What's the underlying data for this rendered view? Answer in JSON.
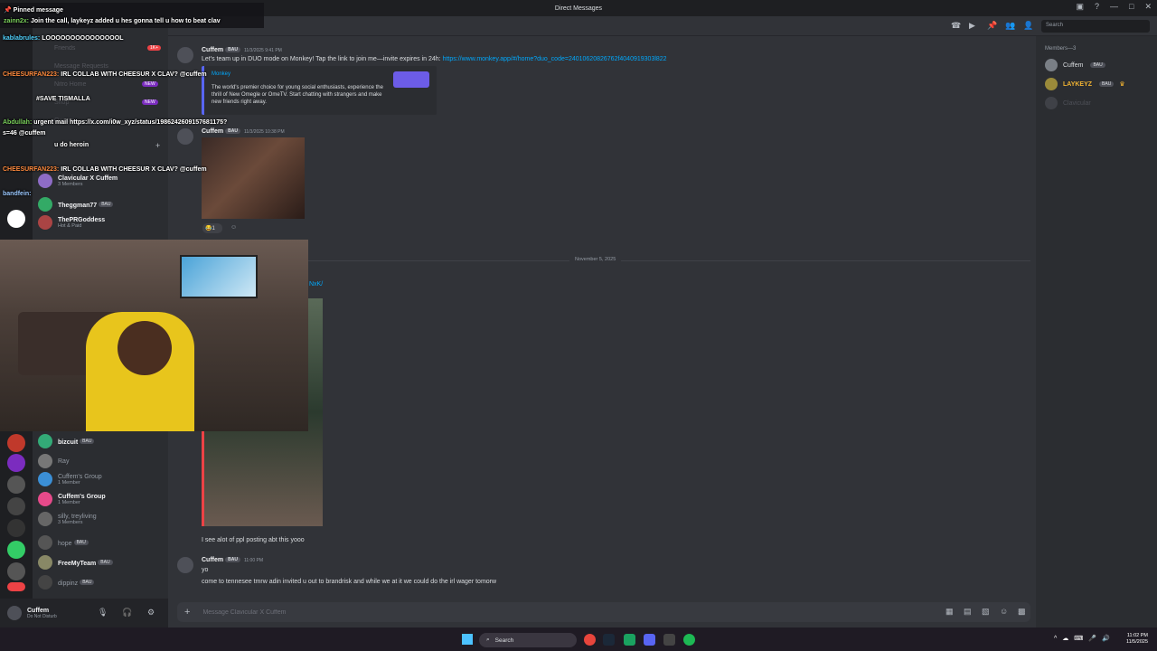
{
  "window": {
    "title": "Direct Messages"
  },
  "overlay_chat": {
    "pinned_label": "Pinned message",
    "pinned_user": "zainn2x:",
    "pinned_text": "Join the call, laykeyz added u hes gonna tell u how to beat clav",
    "lines": [
      {
        "user": "kablabrules:",
        "text": "LOOOOOOOOOOOOOOOL",
        "color": "#52d4ff"
      },
      {
        "user": "CHEESURFAN223:",
        "text": "IRL COLLAB WITH CHEESUR X CLAV? @cuffem",
        "color": "#ff8a3d"
      },
      {
        "user": "",
        "text": "#SAVE TISMALLA",
        "color": "#ffffff"
      },
      {
        "user": "Abdullah:",
        "text": "urgent mail https://x.com/i0w_xyz/status/1986242609157681175?",
        "color": "#7ad05b"
      },
      {
        "user": "",
        "text": "s=46 @cuffem",
        "color": "#ffffff"
      },
      {
        "user": "",
        "text": "u do heroin",
        "color": "#ffffff"
      },
      {
        "user": "CHEESURFAN223:",
        "text": "IRL COLLAB WITH CHEESUR X CLAV? @cuffem",
        "color": "#ff8a3d"
      },
      {
        "user": "bandfein:",
        "text": "",
        "color": "#9bc8ff"
      }
    ]
  },
  "sidebar": {
    "faded": [
      "Friends",
      "Message Requests",
      "Nitro Home",
      "Shop",
      "Quests"
    ],
    "faded_badges": [
      "1K+",
      "NEW",
      "NEW"
    ],
    "dms": [
      {
        "name": "Clavicular X Cuffem",
        "sub": "3 Members",
        "dim": false
      },
      {
        "name": "Theggman77",
        "tag": "BAU",
        "sub": "",
        "dim": false
      },
      {
        "name": "ThePRGoddess",
        "tag": "",
        "sub": "Hot & Paid",
        "dim": false
      },
      {
        "name": "bizcuit",
        "tag": "BAU",
        "sub": "",
        "dim": false
      },
      {
        "name": "Ray",
        "tag": "",
        "sub": "",
        "dim": true
      },
      {
        "name": "Cuffem's Group",
        "tag": "",
        "sub": "1 Member",
        "dim": true
      },
      {
        "name": "Cuffem's Group",
        "tag": "",
        "sub": "1 Member",
        "dim": false
      },
      {
        "name": "silly, treyliving",
        "tag": "",
        "sub": "3 Members",
        "dim": true
      },
      {
        "name": "hope",
        "tag": "BAU",
        "sub": "",
        "dim": true
      },
      {
        "name": "FreeMyTeam",
        "tag": "BAU",
        "sub": "",
        "dim": false
      },
      {
        "name": "dippinz",
        "tag": "BAU",
        "sub": "",
        "dim": true
      }
    ]
  },
  "user_panel": {
    "name": "Cuffem",
    "status": "Do Not Disturb"
  },
  "messages": [
    {
      "author": "Cuffem",
      "tag": "BAU",
      "time": "11/3/2025 9:41 PM",
      "text": "Let's team up in DUO mode on Monkey! Tap the link to join me—invite expires in 24h:",
      "link": "https://www.monkey.app/#/home?duo_code=24010620826762f4040919303l822"
    },
    {
      "author": "Cuffem",
      "tag": "BAU",
      "time": "11/3/2025 10:38 PM"
    },
    {
      "author": "",
      "text": "I see alot of ppl posting abt this yooo"
    },
    {
      "author": "Cuffem",
      "tag": "BAU",
      "time": "11:00 PM",
      "lines": [
        "yo",
        "come to tennesee tmrw adin invited u out to brandrisk and while we at it we could do the irl wager tomorw"
      ]
    }
  ],
  "embed": {
    "provider": "Monkey",
    "description": "The world's premier choice for young social enthusiasts, experience the thrill of New Omegle or OmeTV. Start chatting with strangers and make new friends right away."
  },
  "reaction": {
    "count": "1"
  },
  "date_separator": "November 5, 2025",
  "partial_link": "NxK/",
  "composer": {
    "placeholder": "Message Clavicular X Cuffem"
  },
  "members": {
    "header": "Members—3",
    "list": [
      {
        "name": "Cuffem",
        "tag": "BAU",
        "color": "#dbdee1"
      },
      {
        "name": "LAYKEYZ",
        "tag": "BAU",
        "color": "#f0b232"
      },
      {
        "name": "Clavicular",
        "tag": "",
        "color": "#4e5058"
      }
    ]
  },
  "search": {
    "placeholder": "Search"
  },
  "taskbar": {
    "search_label": "Search",
    "time": "11:02 PM",
    "date": "11/5/2025"
  },
  "colors": {
    "accent": "#5865f2",
    "link": "#00a8fc",
    "bg": "#313338"
  }
}
